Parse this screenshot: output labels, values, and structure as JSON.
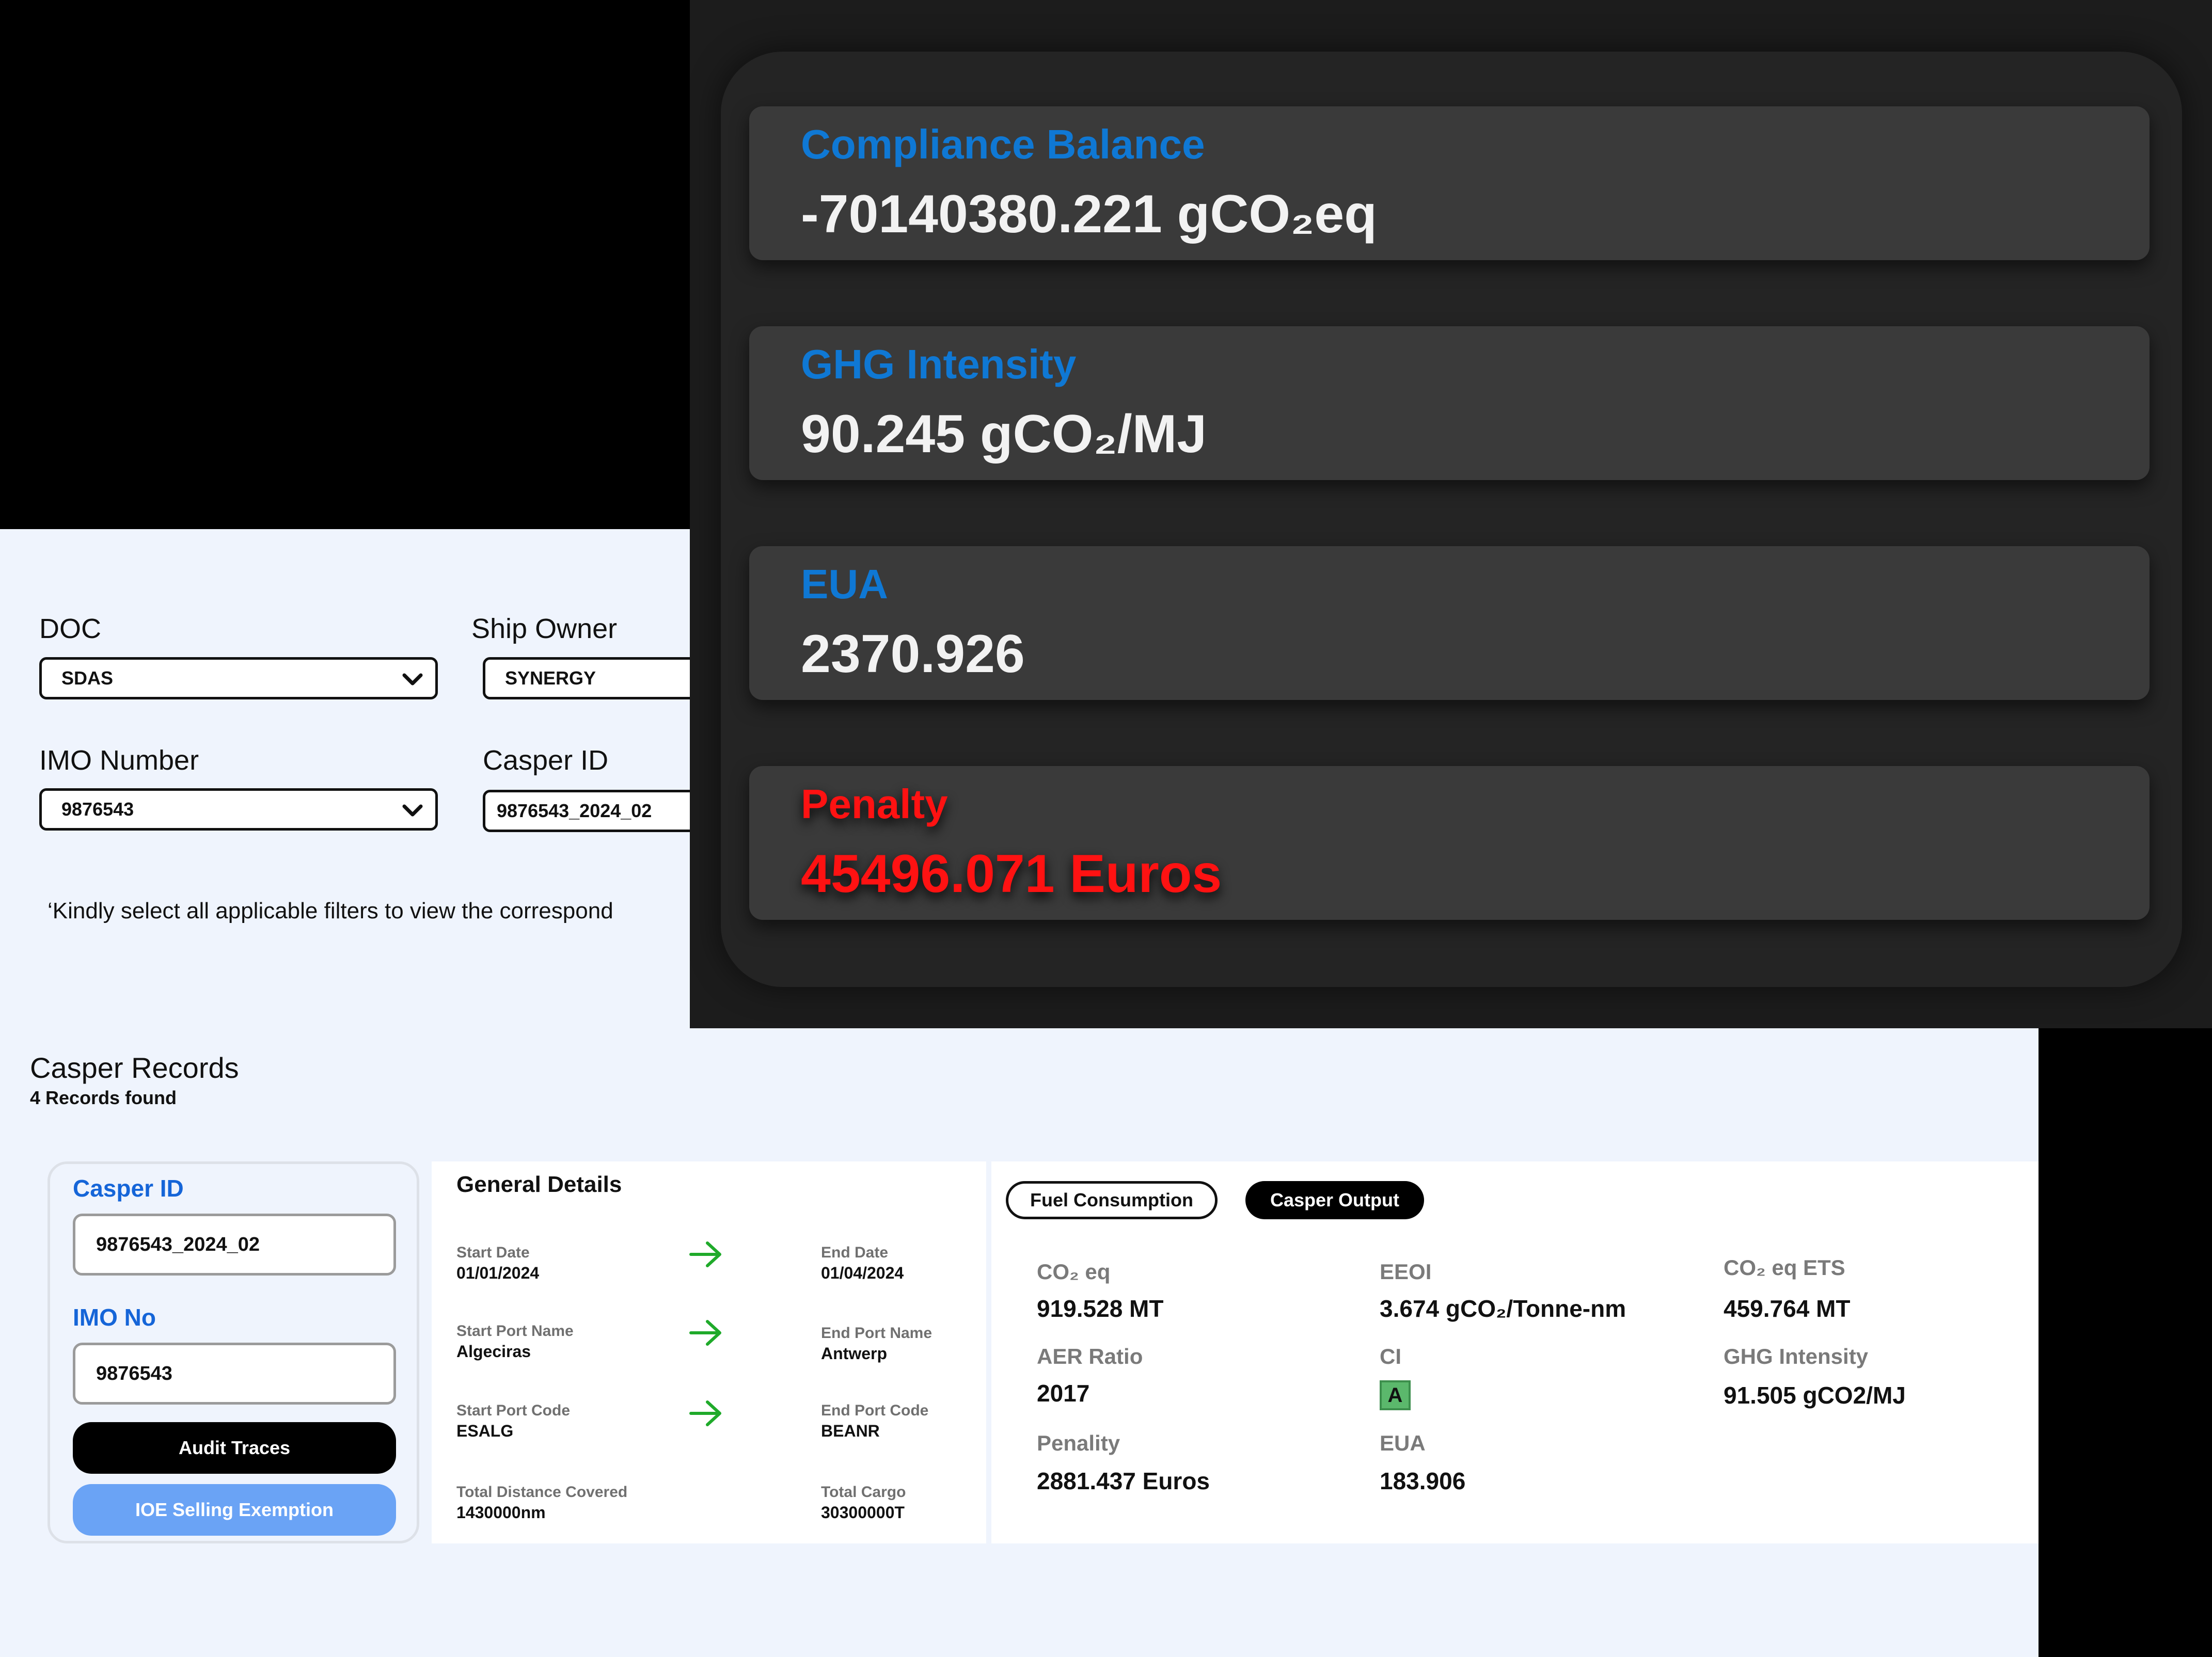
{
  "filters": {
    "doc_label": "DOC",
    "doc_value": "SDAS",
    "owner_label": "Ship Owner",
    "owner_value": "SYNERGY",
    "imo_label": "IMO Number",
    "imo_value": "9876543",
    "casper_label": "Casper ID",
    "casper_value": "9876543_2024_02",
    "note": "‘Kindly select all applicable filters to view the correspond"
  },
  "metrics": {
    "compliance": {
      "title": "Compliance Balance",
      "value": "-70140380.221 gCO₂eq"
    },
    "ghg": {
      "title": "GHG  Intensity",
      "value": "90.245  gCO₂/MJ"
    },
    "eua": {
      "title": "EUA",
      "value": "2370.926"
    },
    "penalty": {
      "title": "Penalty",
      "value": "45496.071 Euros",
      "color": "#ff1212"
    }
  },
  "accent_color": "#0f78d4",
  "records": {
    "title": "Casper Records",
    "count": "4 Records found",
    "card": {
      "casper_label": "Casper ID",
      "casper_value": "9876543_2024_02",
      "imo_label": "IMO No",
      "imo_value": "9876543",
      "audit_button": "Audit Traces",
      "ioe_button": "IOE Selling Exemption"
    },
    "general": {
      "title": "General Details",
      "start_date_label": "Start Date",
      "start_date": "01/01/2024",
      "end_date_label": "End Date",
      "end_date": "01/04/2024",
      "start_port_name_label": "Start Port Name",
      "start_port_name": "Algeciras",
      "end_port_name_label": "End Port Name",
      "end_port_name": "Antwerp",
      "start_port_code_label": "Start Port Code",
      "start_port_code": "ESALG",
      "end_port_code_label": "End Port Code",
      "end_port_code": "BEANR",
      "distance_label": "Total Distance Covered",
      "distance": "1430000nm",
      "cargo_label": "Total Cargo",
      "cargo": "30300000T",
      "arrow_icon": "arrow-right-icon",
      "arrow_color": "#1faa2a"
    },
    "output": {
      "tab_fuel": "Fuel Consumption",
      "tab_casper": "Casper Output",
      "co2_label": "CO₂ eq",
      "co2_value": "919.528 MT",
      "eeoi_label": "EEOI",
      "eeoi_value": "3.674 gCO₂/Tonne-nm",
      "co2ets_label": "CO₂ eq ETS",
      "co2ets_value": "459.764 MT",
      "aer_label": "AER Ratio",
      "aer_value": "2017",
      "ci_label": "CI",
      "ci_value": "A",
      "ghg_label": "GHG Intensity",
      "ghg_value": "91.505 gCO2/MJ",
      "penalty_label": "Penality",
      "penalty_value": "2881.437 Euros",
      "eua_label": "EUA",
      "eua_value": "183.906",
      "ci_badge_color": "#5bb86c"
    }
  }
}
